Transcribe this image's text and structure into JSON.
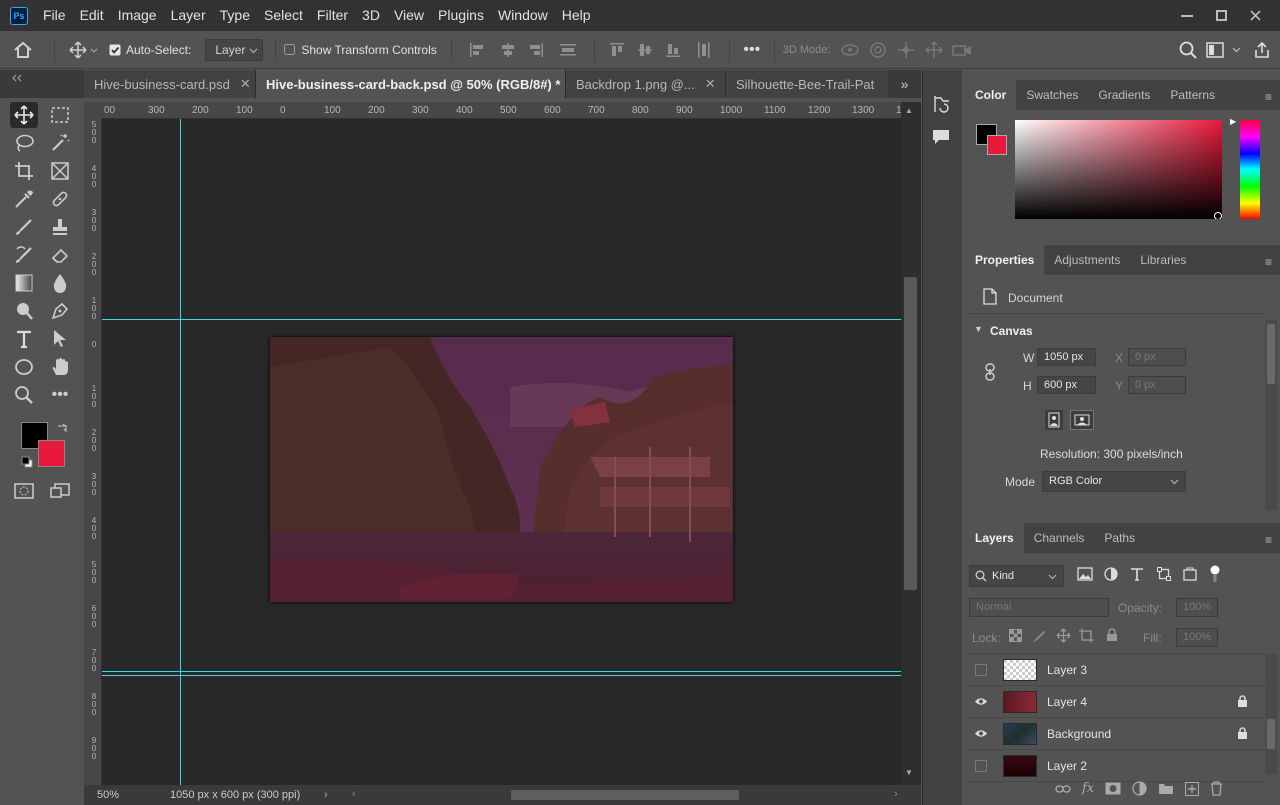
{
  "app": {
    "logo": "Ps"
  },
  "menubar": {
    "items": [
      "File",
      "Edit",
      "Image",
      "Layer",
      "Type",
      "Select",
      "Filter",
      "3D",
      "View",
      "Plugins",
      "Window",
      "Help"
    ]
  },
  "options": {
    "auto_select_label": "Auto-Select:",
    "auto_select_value": "Layer",
    "transform_label": "Show Transform Controls",
    "mode3d_label": "3D Mode:"
  },
  "tabs": [
    {
      "label": "Hive-business-card.psd",
      "active": false
    },
    {
      "label": "Hive-business-card-back.psd @ 50% (RGB/8#) *",
      "active": true
    },
    {
      "label": "Backdrop 1.png @...",
      "active": false
    },
    {
      "label": "Silhouette-Bee-Trail-Pat",
      "active": false
    }
  ],
  "ruler_top": [
    "00",
    "300",
    "200",
    "100",
    "0",
    "100",
    "200",
    "300",
    "400",
    "500",
    "600",
    "700",
    "800",
    "900",
    "1000",
    "1100",
    "1200",
    "1300",
    "14"
  ],
  "ruler_left": [
    "5\n0\n0",
    "4\n0\n0",
    "3\n0\n0",
    "2\n0\n0",
    "1\n0\n0",
    "0",
    "1\n0\n0",
    "2\n0\n0",
    "3\n0\n0",
    "4\n0\n0",
    "5\n0\n0",
    "6\n0\n0",
    "7\n0\n0",
    "8\n0\n0",
    "9\n0\n0"
  ],
  "status": {
    "zoom": "50%",
    "doc_info": "1050 px x 600 px (300 ppi)"
  },
  "color_panel": {
    "tabs": [
      "Color",
      "Swatches",
      "Gradients",
      "Patterns"
    ],
    "foreground": "#000000",
    "background": "#e8193a"
  },
  "properties": {
    "tabs": [
      "Properties",
      "Adjustments",
      "Libraries"
    ],
    "doc_label": "Document",
    "section": "Canvas",
    "w_label": "W",
    "w_value": "1050 px",
    "h_label": "H",
    "h_value": "600 px",
    "x_label": "X",
    "x_value": "0 px",
    "y_label": "Y",
    "y_value": "0 px",
    "resolution": "Resolution: 300 pixels/inch",
    "mode_label": "Mode",
    "mode_value": "RGB Color"
  },
  "layers_panel": {
    "tabs": [
      "Layers",
      "Channels",
      "Paths"
    ],
    "kind_label": "Kind",
    "blend_mode": "Normal",
    "opacity_label": "Opacity:",
    "opacity_value": "100%",
    "lock_label": "Lock:",
    "fill_label": "Fill:",
    "fill_value": "100%",
    "layers": [
      {
        "name": "Layer 3",
        "visible": false,
        "locked": false
      },
      {
        "name": "Layer 4",
        "visible": true,
        "locked": true
      },
      {
        "name": "Background",
        "visible": true,
        "locked": true
      },
      {
        "name": "Layer 2",
        "visible": false,
        "locked": false
      }
    ]
  }
}
